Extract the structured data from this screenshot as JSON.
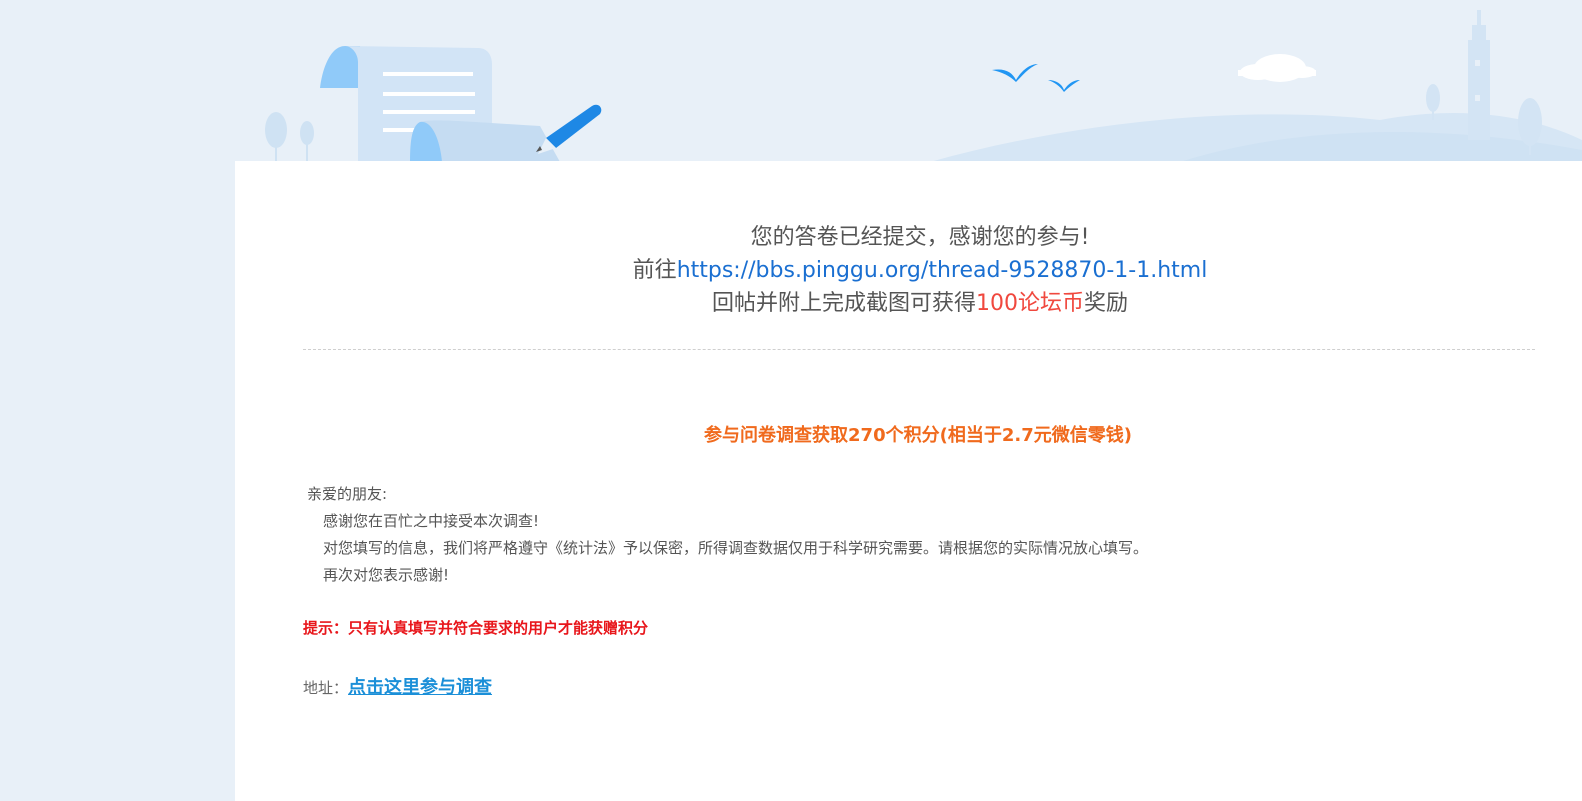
{
  "thanks": {
    "line1": "您的答卷已经提交，感谢您的参与!",
    "goto_prefix": "前往",
    "thread_url": "https://bbs.pinggu.org/thread-9528870-1-1.html",
    "line3_prefix": "回帖并附上完成截图可获得",
    "reward": "100论坛币",
    "line3_suffix": "奖励"
  },
  "survey": {
    "title": "参与问卷调查获取270个积分(相当于2.7元微信零钱)",
    "greeting": "亲爱的朋友:",
    "line1": "感谢您在百忙之中接受本次调查!",
    "line2": "对您填写的信息，我们将严格遵守《统计法》予以保密，所得调查数据仅用于科学研究需要。请根据您的实际情况放心填写。",
    "line3": "再次对您表示感谢!"
  },
  "tip": "提示：只有认真填写并符合要求的用户才能获赠积分",
  "address": {
    "label": "地址：",
    "link_text": "点击这里参与调查"
  },
  "colors": {
    "link": "#1a6fd1",
    "reward": "#f0483e",
    "survey_title": "#f06a1d",
    "tip": "#e8161b",
    "address_link": "#1b8fd8"
  },
  "icons": [
    "scroll-icon",
    "pen-icon",
    "tree-icon",
    "bird-icon",
    "cloud-icon",
    "lighthouse-icon",
    "hill-icon"
  ]
}
